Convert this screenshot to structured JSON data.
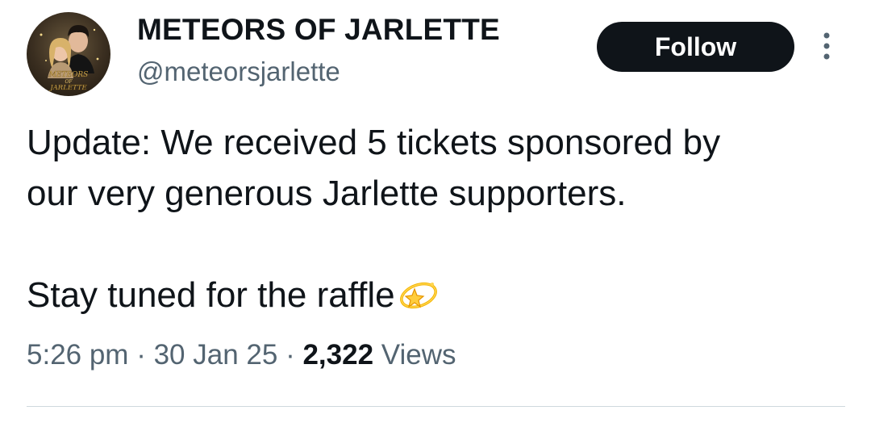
{
  "author": {
    "display_name": "METEORS OF JARLETTE",
    "handle": "@meteorsjarlette",
    "avatar_text_line1": "METEORS",
    "avatar_text_line2": "OF",
    "avatar_text_line3": "JARLETTE"
  },
  "actions": {
    "follow_label": "Follow",
    "more_icon": "more-vertical-icon"
  },
  "tweet": {
    "text_line1": "Update: We received 5 tickets sponsored by",
    "text_line2": "our very generous Jarlette supporters.",
    "text_line3": "Stay tuned for the raffle",
    "emoji": "dizzy-star-emoji"
  },
  "meta": {
    "time": "5:26 pm",
    "separator": "·",
    "date": "30 Jan 25",
    "views_count": "2,322",
    "views_label": "Views"
  },
  "colors": {
    "primary_text": "#0f1419",
    "secondary_text": "#536471",
    "follow_bg": "#0f1419",
    "divider": "#cfd9de"
  }
}
